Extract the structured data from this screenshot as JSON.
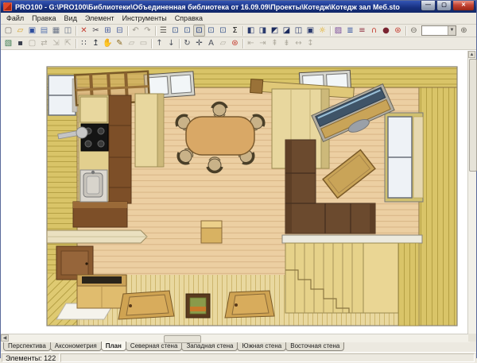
{
  "window": {
    "title": "PRO100 - G:\\PRO100\\Библиотеки\\Объединенная библиотека от 16.09.09\\Проекты\\Котедж\\Котедж зал Меб.sto",
    "controls": [
      {
        "name": "minimize-button",
        "glyph": "—"
      },
      {
        "name": "maximize-button",
        "glyph": "▢"
      },
      {
        "name": "close-button",
        "glyph": "✕",
        "close": true
      }
    ]
  },
  "menu": {
    "items": [
      {
        "name": "menu-file",
        "label": "Файл"
      },
      {
        "name": "menu-edit",
        "label": "Правка"
      },
      {
        "name": "menu-view",
        "label": "Вид"
      },
      {
        "name": "menu-element",
        "label": "Элемент"
      },
      {
        "name": "menu-tools",
        "label": "Инструменты"
      },
      {
        "name": "menu-help",
        "label": "Справка"
      }
    ]
  },
  "toolbar_row1": [
    {
      "name": "new-document-icon",
      "glyph": "▢",
      "color": "#77716a"
    },
    {
      "name": "open-folder-icon",
      "glyph": "▱",
      "color": "#d8a020"
    },
    {
      "name": "save-floppy-icon",
      "glyph": "▣",
      "color": "#2f4f9e"
    },
    {
      "name": "import-model-icon",
      "glyph": "▤",
      "color": "#5a76b0"
    },
    {
      "name": "print-icon",
      "glyph": "▦",
      "color": "#6a7488"
    },
    {
      "name": "print-preview-icon",
      "glyph": "◫",
      "color": "#6a7488"
    },
    {
      "sep": true
    },
    {
      "name": "delete-icon",
      "glyph": "✕",
      "color": "#c43a2e"
    },
    {
      "name": "cut-scissors-icon",
      "glyph": "✂",
      "color": "#44414a"
    },
    {
      "name": "copy-icon",
      "glyph": "⊞",
      "color": "#4a5f9e"
    },
    {
      "name": "paste-icon",
      "glyph": "⊟",
      "color": "#4a5f9e"
    },
    {
      "sep": true
    },
    {
      "name": "undo-icon",
      "glyph": "↶",
      "color": "#9a968c",
      "disabled": true
    },
    {
      "name": "redo-icon",
      "glyph": "↷",
      "color": "#9a968c",
      "disabled": true
    },
    {
      "sep": true
    },
    {
      "name": "properties-icon",
      "glyph": "☰",
      "color": "#5a5650"
    },
    {
      "name": "view-monitor-1-icon",
      "glyph": "⊡",
      "color": "#3f5a8e"
    },
    {
      "name": "view-monitor-2-icon",
      "glyph": "⊡",
      "color": "#3f5a8e"
    },
    {
      "name": "view-monitor-3-icon",
      "glyph": "⊡",
      "color": "#1f3a7e",
      "pressed": true
    },
    {
      "name": "view-monitor-4-icon",
      "glyph": "⊡",
      "color": "#3f5a8e"
    },
    {
      "name": "view-monitor-5-icon",
      "glyph": "⊡",
      "color": "#3f5a8e"
    },
    {
      "name": "report-sum-icon",
      "glyph": "Σ",
      "color": "#1a1a1a"
    },
    {
      "sep": true
    },
    {
      "name": "box-view-1-icon",
      "glyph": "◧",
      "color": "#2a3a6e"
    },
    {
      "name": "box-view-2-icon",
      "glyph": "◨",
      "color": "#2a3a6e"
    },
    {
      "name": "box-view-3-icon",
      "glyph": "◩",
      "color": "#1a2a5e"
    },
    {
      "name": "box-view-4-icon",
      "glyph": "◪",
      "color": "#1a2a5e"
    },
    {
      "name": "box-view-5-icon",
      "glyph": "◫",
      "color": "#2a3a6e"
    },
    {
      "name": "box-view-6-icon",
      "glyph": "▣",
      "color": "#2a3a6e"
    },
    {
      "name": "light-bulb-icon",
      "glyph": "☼",
      "color": "#e0a50a"
    },
    {
      "sep": true
    },
    {
      "name": "textures-icon",
      "glyph": "▨",
      "color": "#7a4a9a"
    },
    {
      "name": "report-list-icon",
      "glyph": "≣",
      "color": "#2f4f9e"
    },
    {
      "name": "price-list-icon",
      "glyph": "≡",
      "color": "#8e2f3f"
    },
    {
      "name": "magnet-snap-icon",
      "glyph": "∩",
      "color": "#c43a2e"
    },
    {
      "name": "render-sphere-icon",
      "glyph": "●",
      "color": "#7a2430"
    },
    {
      "name": "color-wheel-icon",
      "glyph": "⊛",
      "color": "#c43a2e"
    },
    {
      "sep": true
    },
    {
      "name": "zoom-out-icon",
      "glyph": "⊖",
      "color": "#6a665e"
    },
    {
      "combo": true,
      "name": "zoom-level-combo"
    },
    {
      "name": "zoom-in-icon",
      "glyph": "⊕",
      "color": "#6a665e"
    }
  ],
  "zoom_combo": {
    "value": "",
    "arrow": "▼"
  },
  "toolbar_row2": [
    {
      "name": "insert-image-icon",
      "glyph": "▧",
      "color": "#3a7a4e"
    },
    {
      "name": "background-icon",
      "glyph": "▪",
      "color": "#3a3f4e"
    },
    {
      "name": "page-setup-icon",
      "glyph": "▢",
      "color": "#b0aca0",
      "disabled": true
    },
    {
      "name": "pan-view-icon",
      "glyph": "⇄",
      "color": "#b0aca0",
      "disabled": true
    },
    {
      "name": "fit-window-icon",
      "glyph": "⇲",
      "color": "#b0aca0",
      "disabled": true
    },
    {
      "name": "fit-selection-icon",
      "glyph": "⇱",
      "color": "#b0aca0",
      "disabled": true
    },
    {
      "sep": true
    },
    {
      "name": "snap-grid-icon",
      "glyph": "∷",
      "color": "#2a2f3a"
    },
    {
      "name": "move-vertical-icon",
      "glyph": "↥",
      "color": "#2a2f3a"
    },
    {
      "name": "hand-pan-icon",
      "glyph": "✋",
      "color": "#8a6a42"
    },
    {
      "name": "draw-pencil-icon",
      "glyph": "✎",
      "color": "#8a6a22"
    },
    {
      "name": "select-rect-icon",
      "glyph": "▱",
      "color": "#b0aca0",
      "disabled": true
    },
    {
      "name": "select-all-icon",
      "glyph": "▭",
      "color": "#b0aca0",
      "disabled": true
    },
    {
      "sep": true
    },
    {
      "name": "move-up-icon",
      "glyph": "↑",
      "color": "#4a4f5a"
    },
    {
      "name": "move-down-icon",
      "glyph": "↓",
      "color": "#4a4f5a"
    },
    {
      "sep": true
    },
    {
      "name": "rotate-icon",
      "glyph": "↻",
      "color": "#4a4f5a"
    },
    {
      "name": "move-cross-icon",
      "glyph": "✛",
      "color": "#4a4f5a"
    },
    {
      "name": "dimensions-icon",
      "glyph": "A",
      "color": "#4a4f5a"
    },
    {
      "name": "edit-shape-icon",
      "glyph": "▱",
      "color": "#b0aca0",
      "disabled": true
    },
    {
      "name": "render-settings-icon",
      "glyph": "⊛",
      "color": "#c43a2e"
    },
    {
      "sep": true
    },
    {
      "name": "align-left-icon",
      "glyph": "⇤",
      "color": "#b0aca0",
      "disabled": true
    },
    {
      "name": "align-right-icon",
      "glyph": "⇥",
      "color": "#b0aca0",
      "disabled": true
    },
    {
      "name": "align-top-icon",
      "glyph": "⇞",
      "color": "#b0aca0",
      "disabled": true
    },
    {
      "name": "align-bottom-icon",
      "glyph": "⇟",
      "color": "#b0aca0",
      "disabled": true
    },
    {
      "name": "center-h-icon",
      "glyph": "↔",
      "color": "#b0aca0",
      "disabled": true
    },
    {
      "name": "center-v-icon",
      "glyph": "↕",
      "color": "#b0aca0",
      "disabled": true
    }
  ],
  "view_tabs": {
    "items": [
      {
        "name": "tab-perspective",
        "label": "Перспектива",
        "active": false
      },
      {
        "name": "tab-axonometry",
        "label": "Аксонометрия",
        "active": false
      },
      {
        "name": "tab-plan",
        "label": "План",
        "active": true
      },
      {
        "name": "tab-north-wall",
        "label": "Северная стена",
        "active": false
      },
      {
        "name": "tab-west-wall",
        "label": "Западная стена",
        "active": false
      },
      {
        "name": "tab-south-wall",
        "label": "Южная стена",
        "active": false
      },
      {
        "name": "tab-east-wall",
        "label": "Восточная стена",
        "active": false
      }
    ]
  },
  "status_bar": {
    "text": "Элементы: 122"
  },
  "canvas": {
    "palette": {
      "wall": "#d9c468",
      "wall_line": "#a89040",
      "floor": "#eccfa2",
      "floor_line": "#d8b586",
      "floor_bottom": "#e9d89f",
      "wood": "#cfa352",
      "wood_dark": "#7d4f28",
      "sofa": "#6b4a2e",
      "table": "#d9a866",
      "stove": "#141414",
      "window_glass": "#eef2f6",
      "window_frame": "#6a7078",
      "tv_screen": "#3f5468",
      "stairs": "#e6d28a",
      "railing": "#eceadf"
    },
    "scene_items": [
      "kitchen-cabinets",
      "stove",
      "sink",
      "dining-table",
      "dining-chairs",
      "tall-cabinet",
      "partition-cabinet",
      "tv-stand",
      "coffee-table",
      "corner-sofa",
      "staircase",
      "chest",
      "wall-shelf",
      "door-panel",
      "flat-doors",
      "picture-frame",
      "windows",
      "pergola-beams"
    ]
  }
}
